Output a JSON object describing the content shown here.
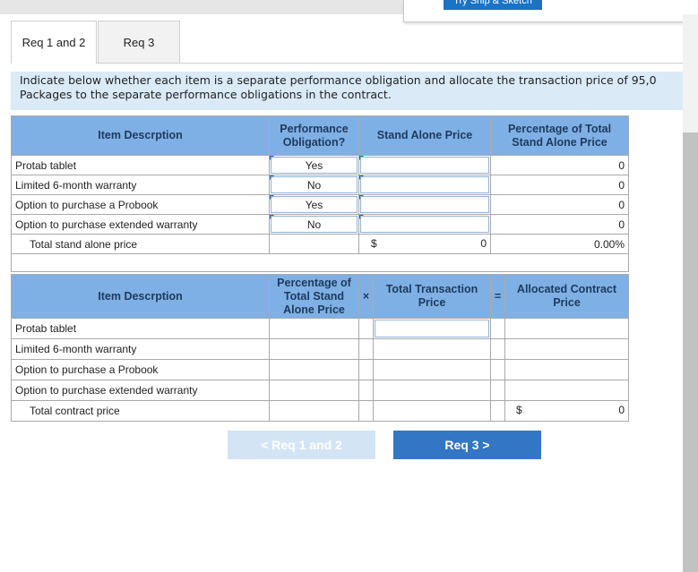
{
  "popup": {
    "button_label": "Try Snip & Sketch"
  },
  "tabs": [
    {
      "label": "Req 1 and 2",
      "active": true
    },
    {
      "label": "Req 3",
      "active": false
    }
  ],
  "instructions": {
    "line1": "Indicate below whether each item is a separate performance obligation and allocate the transaction price of 95,0",
    "line2": "Packages to the separate performance obligations in the contract."
  },
  "table1": {
    "headers": {
      "item": "Item Descrption",
      "obligation": "Performance Obligation?",
      "standalone": "Stand Alone Price",
      "percent": "Percentage of Total Stand Alone Price"
    },
    "rows": [
      {
        "item": "Protab tablet",
        "obligation": "Yes",
        "percent": "0"
      },
      {
        "item": "Limited 6-month warranty",
        "obligation": "No",
        "percent": "0"
      },
      {
        "item": "Option to purchase a Probook",
        "obligation": "Yes",
        "percent": "0"
      },
      {
        "item": "Option to purchase extended warranty",
        "obligation": "No",
        "percent": "0"
      }
    ],
    "total": {
      "label": "Total stand alone price",
      "currency": "$",
      "value": "0",
      "percent": "0.00%"
    }
  },
  "table2": {
    "headers": {
      "item": "Item Descrption",
      "percent": "Percentage of Total Stand Alone Price",
      "times": "×",
      "transaction": "Total Transaction Price",
      "equals": "=",
      "allocated": "Allocated Contract Price"
    },
    "rows": [
      {
        "item": "Protab tablet"
      },
      {
        "item": "Limited 6-month warranty"
      },
      {
        "item": "Option to purchase a Probook"
      },
      {
        "item": "Option to purchase extended warranty"
      }
    ],
    "total": {
      "label": "Total contract price",
      "currency": "$",
      "value": "0"
    }
  },
  "nav": {
    "prev_label": "< Req 1 and 2",
    "next_label": "Req 3 >"
  }
}
